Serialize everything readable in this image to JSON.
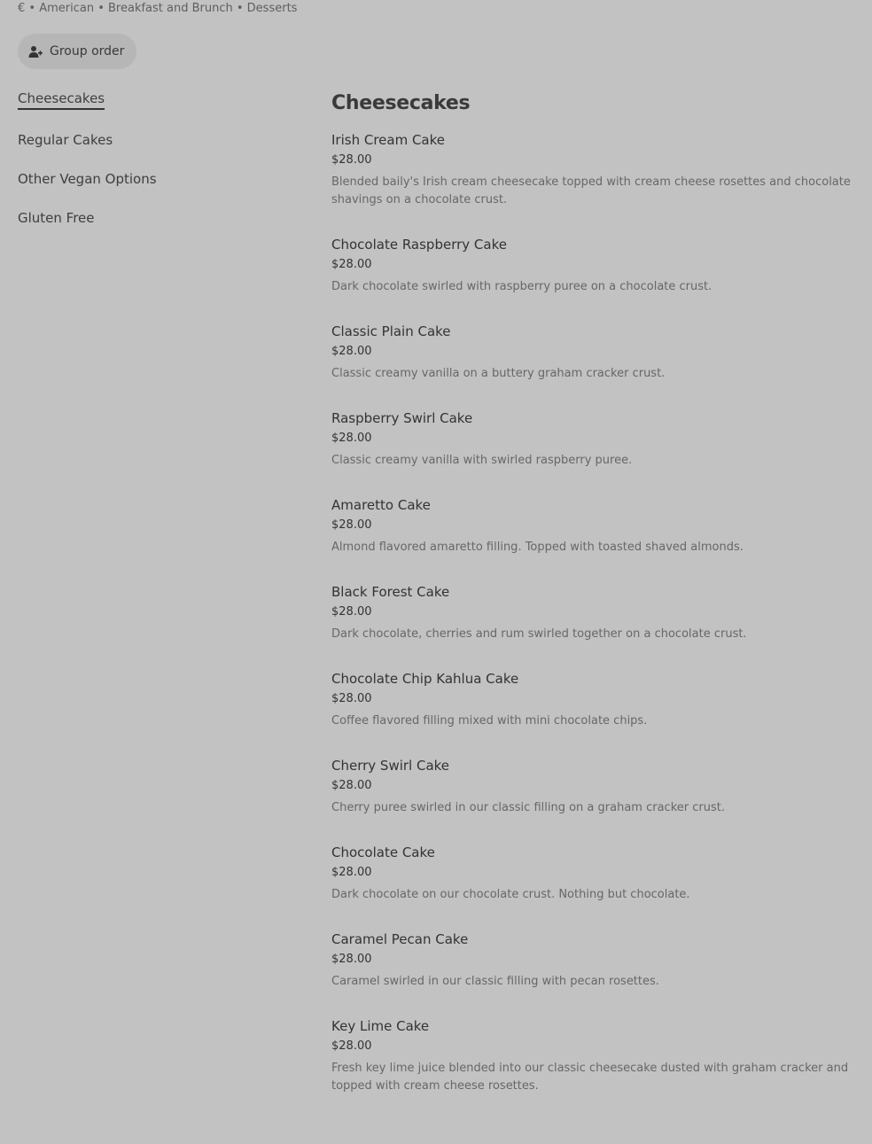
{
  "header": {
    "subtitle": "€ • American • Breakfast and Brunch • Desserts",
    "group_order_label": "Group order",
    "group_order_icon": "add-person-icon"
  },
  "nav": {
    "items": [
      {
        "label": "Cheesecakes",
        "active": true
      },
      {
        "label": "Regular Cakes",
        "active": false
      },
      {
        "label": "Other Vegan Options",
        "active": false
      },
      {
        "label": "Gluten Free",
        "active": false
      }
    ]
  },
  "menu": {
    "section_title": "Cheesecakes",
    "items": [
      {
        "name": "Irish Cream Cake",
        "price": "$28.00",
        "description": "Blended baily's Irish cream cheesecake topped with cream cheese rosettes and chocolate shavings on a chocolate crust."
      },
      {
        "name": "Chocolate Raspberry Cake",
        "price": "$28.00",
        "description": "Dark chocolate swirled with raspberry puree on a chocolate crust."
      },
      {
        "name": "Classic Plain Cake",
        "price": "$28.00",
        "description": "Classic creamy vanilla on a buttery graham cracker crust."
      },
      {
        "name": "Raspberry Swirl Cake",
        "price": "$28.00",
        "description": "Classic creamy vanilla with swirled raspberry puree."
      },
      {
        "name": "Amaretto Cake",
        "price": "$28.00",
        "description": "Almond flavored amaretto filling. Topped with toasted shaved almonds."
      },
      {
        "name": "Black Forest Cake",
        "price": "$28.00",
        "description": "Dark chocolate, cherries and rum swirled together on a chocolate crust."
      },
      {
        "name": "Chocolate Chip Kahlua Cake",
        "price": "$28.00",
        "description": "Coffee flavored filling mixed with mini chocolate chips."
      },
      {
        "name": "Cherry Swirl Cake",
        "price": "$28.00",
        "description": "Cherry puree swirled in our classic filling on a graham cracker crust."
      },
      {
        "name": "Chocolate Cake",
        "price": "$28.00",
        "description": "Dark chocolate on our chocolate crust. Nothing but chocolate."
      },
      {
        "name": "Caramel Pecan Cake",
        "price": "$28.00",
        "description": "Caramel swirled in our classic filling with pecan rosettes."
      },
      {
        "name": "Key Lime Cake",
        "price": "$28.00",
        "description": "Fresh key lime juice blended into our classic cheesecake dusted with graham cracker and topped with cream cheese rosettes."
      }
    ]
  }
}
